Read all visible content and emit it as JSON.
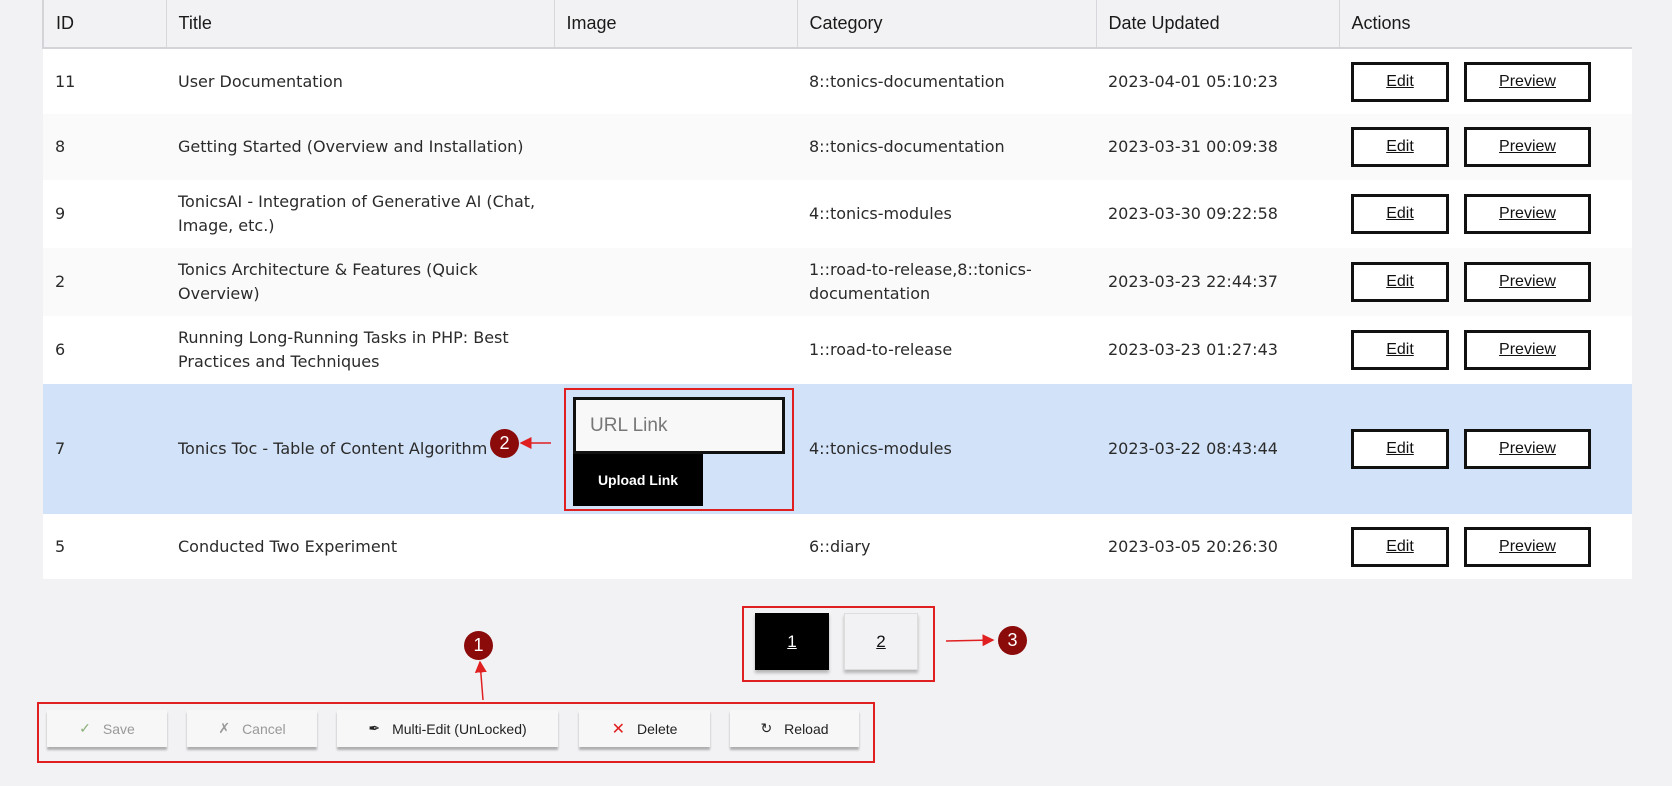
{
  "columns": [
    "ID",
    "Title",
    "Image",
    "Category",
    "Date Updated",
    "Actions"
  ],
  "rows": [
    {
      "id": "11",
      "title": "User Documentation",
      "category": "8::tonics-documentation",
      "date": "2023-04-01 05:10:23"
    },
    {
      "id": "8",
      "title": "Getting Started (Overview and Installation)",
      "category": "8::tonics-documentation",
      "date": "2023-03-31 00:09:38"
    },
    {
      "id": "9",
      "title": "TonicsAI - Integration of Generative AI (Chat, Image, etc.)",
      "category": "4::tonics-modules",
      "date": "2023-03-30 09:22:58"
    },
    {
      "id": "2",
      "title": "Tonics Architecture & Features (Quick Overview)",
      "category": "1::road-to-release,8::tonics-documentation",
      "date": "2023-03-23 22:44:37"
    },
    {
      "id": "6",
      "title": "Running Long-Running Tasks in PHP: Best Practices and Techniques",
      "category": "1::road-to-release",
      "date": "2023-03-23 01:27:43"
    },
    {
      "id": "7",
      "title": "Tonics Toc - Table of Content Algorithm",
      "category": "4::tonics-modules",
      "date": "2023-03-22 08:43:44"
    },
    {
      "id": "5",
      "title": "Conducted Two Experiment",
      "category": "6::diary",
      "date": "2023-03-05 20:26:30"
    }
  ],
  "row_actions": {
    "edit": "Edit",
    "preview": "Preview"
  },
  "image_editor": {
    "placeholder": "URL Link",
    "upload_label": "Upload Link"
  },
  "pagination": {
    "pages": [
      "1",
      "2"
    ],
    "current": "1"
  },
  "toolbar": {
    "save": "Save",
    "cancel": "Cancel",
    "multi_edit": "Multi-Edit (UnLocked)",
    "delete": "Delete",
    "reload": "Reload"
  },
  "callouts": [
    "1",
    "2",
    "3"
  ],
  "colors": {
    "selected_row": "#d2e2f8",
    "callout": "#8b0a0a",
    "highlight_box": "#e02020"
  }
}
